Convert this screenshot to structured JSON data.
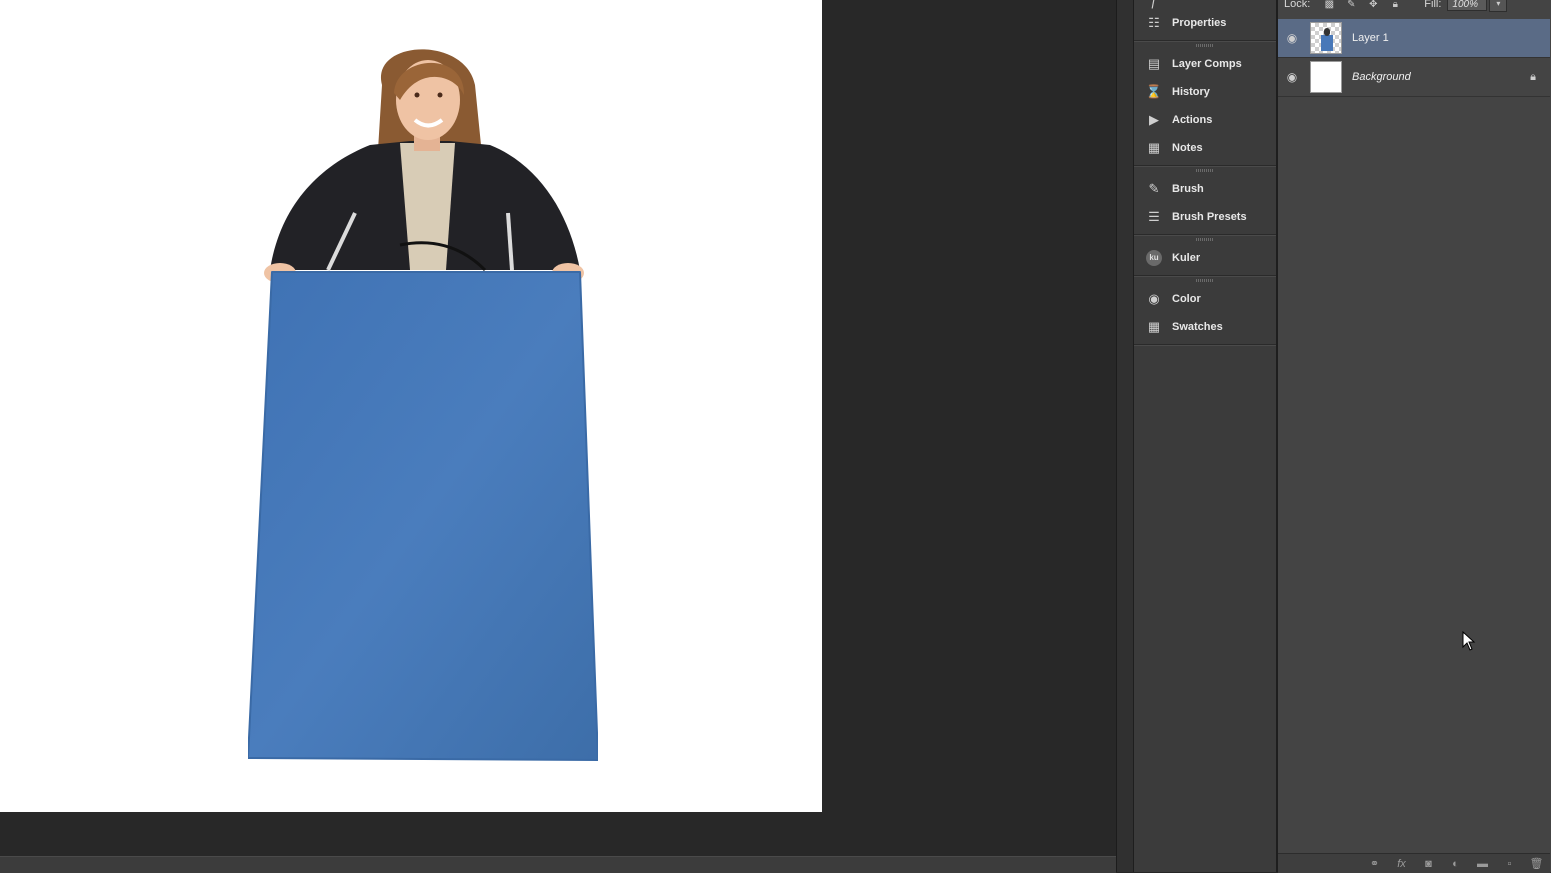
{
  "dock": {
    "items": [
      {
        "label": "Properties",
        "icon": "properties-icon"
      },
      {
        "label": "Layer Comps",
        "icon": "layer-comps-icon"
      },
      {
        "label": "History",
        "icon": "history-icon"
      },
      {
        "label": "Actions",
        "icon": "actions-icon"
      },
      {
        "label": "Notes",
        "icon": "notes-icon"
      },
      {
        "label": "Brush",
        "icon": "brush-icon"
      },
      {
        "label": "Brush Presets",
        "icon": "brush-presets-icon"
      },
      {
        "label": "Kuler",
        "icon": "kuler-icon"
      },
      {
        "label": "Color",
        "icon": "color-icon"
      },
      {
        "label": "Swatches",
        "icon": "swatches-icon"
      }
    ]
  },
  "layers": {
    "lock_label": "Lock:",
    "fill_label": "Fill:",
    "fill_value": "100%",
    "rows": [
      {
        "name": "Layer 1",
        "selected": true
      },
      {
        "name": "Background",
        "selected": false,
        "locked": true
      }
    ]
  },
  "colors": {
    "selection": "#5a6b86",
    "podium": "#4878b8",
    "panel": "#444444"
  }
}
